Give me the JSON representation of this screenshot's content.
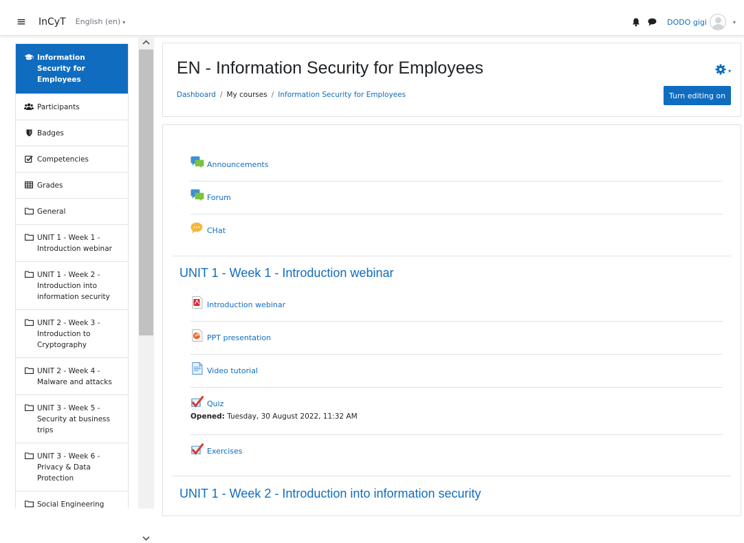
{
  "navbar": {
    "brand": "InCyT",
    "language": "English (en)",
    "username": "DODO gigi"
  },
  "drawer": {
    "items": [
      {
        "label": "Information Security for Employees",
        "icon": "graduation-cap-icon",
        "active": true
      },
      {
        "label": "Participants",
        "icon": "users-icon"
      },
      {
        "label": "Badges",
        "icon": "shield-icon"
      },
      {
        "label": "Competencies",
        "icon": "check-square-icon"
      },
      {
        "label": "Grades",
        "icon": "table-icon"
      },
      {
        "label": "General",
        "icon": "folder-icon"
      },
      {
        "label": "UNIT 1 - Week 1 - Introduction webinar",
        "icon": "folder-icon"
      },
      {
        "label": "UNIT 1 - Week 2 - Introduction into information security",
        "icon": "folder-icon"
      },
      {
        "label": "UNIT 2 - Week 3 - Introduction to Cryptography",
        "icon": "folder-icon"
      },
      {
        "label": "UNIT 2 - Week 4 - Malware and attacks",
        "icon": "folder-icon"
      },
      {
        "label": "UNIT 3 - Week 5 - Security at business trips",
        "icon": "folder-icon"
      },
      {
        "label": "UNIT 3 - Week 6 - Privacy & Data Protection",
        "icon": "folder-icon"
      },
      {
        "label": "Social Engineering",
        "icon": "folder-icon"
      }
    ]
  },
  "header": {
    "title": "EN - Information Security for Employees",
    "breadcrumb": {
      "dashboard": "Dashboard",
      "sep": "/",
      "my_courses": "My courses",
      "course": "Information Security for Employees"
    },
    "edit_button": "Turn editing on"
  },
  "content": {
    "general_activities": [
      {
        "label": "Announcements",
        "icon": "forum-icon"
      },
      {
        "label": "Forum",
        "icon": "forum-icon"
      },
      {
        "label": "CHat",
        "icon": "chat-icon"
      }
    ],
    "section1": {
      "title": "UNIT 1 - Week 1 - Introduction webinar",
      "activities": [
        {
          "label": "Introduction webinar",
          "icon": "pdf-icon"
        },
        {
          "label": "PPT presentation",
          "icon": "ppt-icon"
        },
        {
          "label": "Video tutorial",
          "icon": "file-icon"
        },
        {
          "label": "Quiz",
          "icon": "quiz-icon",
          "meta_label": "Opened:",
          "meta_value": "Tuesday, 30 August 2022, 11:32 AM"
        },
        {
          "label": "Exercises",
          "icon": "quiz-icon"
        }
      ]
    },
    "section2": {
      "title": "UNIT 1 - Week 2 - Introduction into information security"
    }
  },
  "colors": {
    "primary": "#0f6cbf",
    "border": "#dee2e6",
    "text": "#1d2125"
  }
}
